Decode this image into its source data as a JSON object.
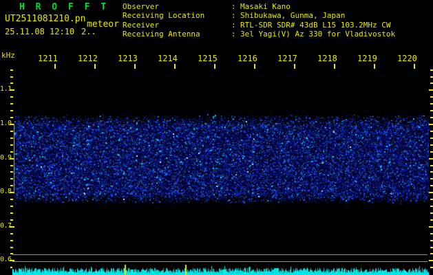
{
  "app": {
    "title": "H R O F F T"
  },
  "header": {
    "filename": "UT2511081210.pn",
    "station": "meteor",
    "datetime": "25.11.08 12:10",
    "counter": "2..",
    "separator": ":",
    "info": [
      {
        "label": "Observer",
        "value": "Masaki Kano"
      },
      {
        "label": "Receiving Location",
        "value": "Shibukawa, Gunma, Japan"
      },
      {
        "label": "Receiver",
        "value": "RTL-SDR SDR# 43dB L15 103.2MHz CW"
      },
      {
        "label": "Receiving Antenna",
        "value": "3el Yagi(V) Az 330 for Vladivostok"
      }
    ]
  },
  "plot": {
    "y_axis_unit": "kHz",
    "time_labels": [
      "1211",
      "1212",
      "1213",
      "1214",
      "1215",
      "1216",
      "1217",
      "1218",
      "1219",
      "1220"
    ],
    "freq_labels": [
      "1.1",
      "1.0",
      "0.9",
      "0.8",
      "0.7",
      "0.6"
    ],
    "freq_label_values": [
      1.1,
      1.0,
      0.9,
      0.8,
      0.7,
      0.6
    ],
    "spectrogram": {
      "description": "random blue noise band, no meteor echoes",
      "noise_band_khz": [
        0.8,
        1.0
      ],
      "freq_axis_range_khz": [
        0.57,
        1.17
      ],
      "time_axis_range_ut": [
        "12:11",
        "12:20"
      ]
    },
    "colors": {
      "title_green": "#00DE2C",
      "text_yellow": "#E8E800",
      "tick_yellow": "#E8E800",
      "ref_gray": "#8c8c8c",
      "noise_blue": "#0000a0",
      "noise_bright": "#00c8ff",
      "level_cyan": "#00e8e8",
      "marker_yellow": "#e8e800",
      "background": "#000000"
    },
    "level_strip": {
      "markers": 2
    }
  }
}
